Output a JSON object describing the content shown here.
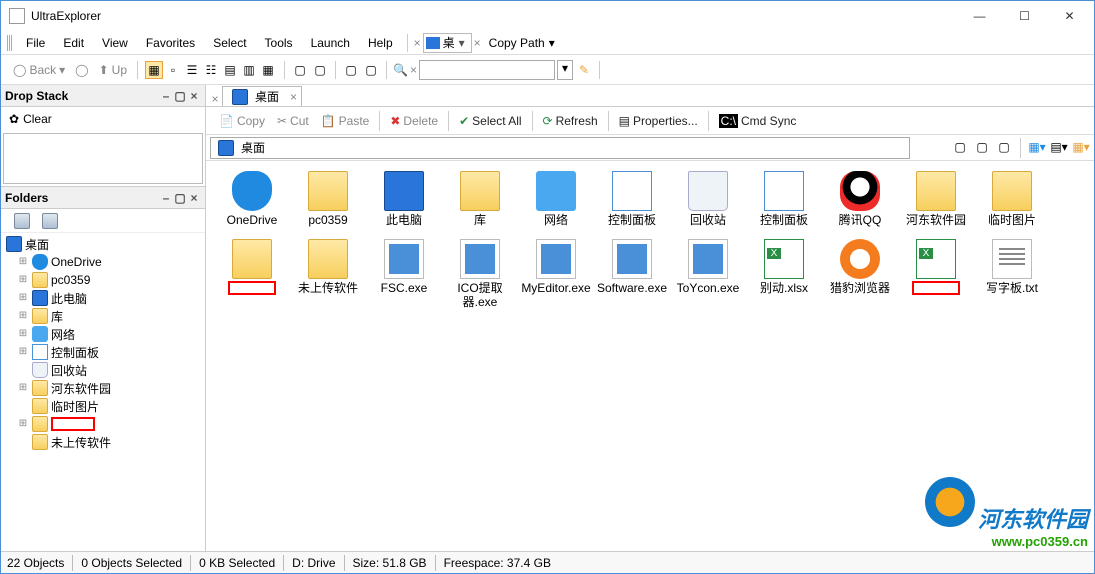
{
  "window": {
    "title": "UltraExplorer"
  },
  "menu": {
    "file": "File",
    "edit": "Edit",
    "view": "View",
    "favorites": "Favorites",
    "select": "Select",
    "tools": "Tools",
    "launch": "Launch",
    "help": "Help",
    "path_sel": "桌",
    "copy_path": "Copy Path"
  },
  "navbar": {
    "back": "Back",
    "up": "Up"
  },
  "search": {
    "placeholder": ""
  },
  "drop_stack": {
    "title": "Drop Stack",
    "clear": "Clear"
  },
  "folders": {
    "title": "Folders",
    "root": "桌面",
    "items": [
      {
        "label": "OneDrive",
        "icon": "cloud",
        "exp": true
      },
      {
        "label": "pc0359",
        "icon": "folder",
        "exp": true
      },
      {
        "label": "此电脑",
        "icon": "monitor",
        "exp": true
      },
      {
        "label": "库",
        "icon": "folder",
        "exp": true
      },
      {
        "label": "网络",
        "icon": "network",
        "exp": true
      },
      {
        "label": "控制面板",
        "icon": "panel",
        "exp": true
      },
      {
        "label": "回收站",
        "icon": "recycle",
        "exp": false
      },
      {
        "label": "河东软件园",
        "icon": "folder",
        "exp": true
      },
      {
        "label": "临时图片",
        "icon": "folder",
        "exp": false
      },
      {
        "label": "",
        "icon": "folder",
        "exp": true,
        "red": true
      },
      {
        "label": "未上传软件",
        "icon": "folder",
        "exp": false
      }
    ]
  },
  "tab": {
    "label": "桌面"
  },
  "actions": {
    "copy": "Copy",
    "cut": "Cut",
    "paste": "Paste",
    "delete": "Delete",
    "select_all": "Select All",
    "refresh": "Refresh",
    "properties": "Properties...",
    "cmd_sync": "Cmd Sync"
  },
  "location": {
    "label": "桌面"
  },
  "files": [
    {
      "label": "OneDrive",
      "icon": "cloud"
    },
    {
      "label": "pc0359",
      "icon": "folder"
    },
    {
      "label": "此电脑",
      "icon": "monitor"
    },
    {
      "label": "库",
      "icon": "folder"
    },
    {
      "label": "网络",
      "icon": "network"
    },
    {
      "label": "控制面板",
      "icon": "panel"
    },
    {
      "label": "回收站",
      "icon": "recycle"
    },
    {
      "label": "控制面板",
      "icon": "panel"
    },
    {
      "label": "腾讯QQ",
      "icon": "qq"
    },
    {
      "label": "河东软件园",
      "icon": "folder"
    },
    {
      "label": "临时图片",
      "icon": "folder"
    },
    {
      "label": "",
      "icon": "folder",
      "red": true
    },
    {
      "label": "未上传软件",
      "icon": "folder"
    },
    {
      "label": "FSC.exe",
      "icon": "exe"
    },
    {
      "label": "ICO提取器.exe",
      "icon": "exe"
    },
    {
      "label": "MyEditor.exe",
      "icon": "exe"
    },
    {
      "label": "Software.exe",
      "icon": "exe"
    },
    {
      "label": "ToYcon.exe",
      "icon": "exe"
    },
    {
      "label": "别动.xlsx",
      "icon": "xlsx"
    },
    {
      "label": "猎豹浏览器",
      "icon": "liebao"
    },
    {
      "label": "",
      "icon": "xlsx",
      "red": true
    },
    {
      "label": "写字板.txt",
      "icon": "txt"
    }
  ],
  "status": {
    "objects": "22 Objects",
    "selected": "0 Objects Selected",
    "kb": "0 KB Selected",
    "drive": "D: Drive",
    "size": "Size: 51.8 GB",
    "free": "Freespace: 37.4 GB"
  },
  "watermark": {
    "t1": "河东软件园",
    "t2": "www.pc0359.cn"
  }
}
